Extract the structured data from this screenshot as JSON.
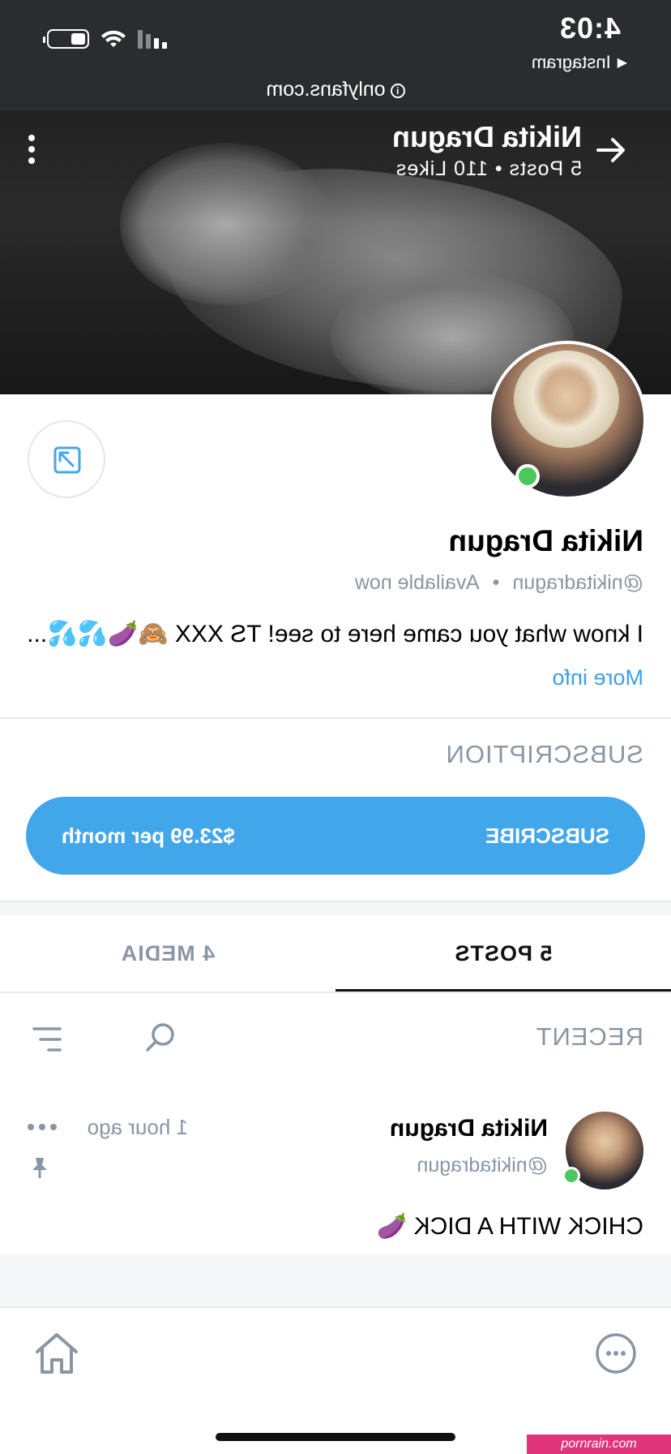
{
  "status_bar": {
    "time": "4:03",
    "back_app": "Instagram",
    "url": "onlyfans.com"
  },
  "cover": {
    "name": "Nikita Dragun",
    "stats": "5 Posts  •  110 Likes"
  },
  "profile": {
    "name": "Nikita Dragun",
    "handle": "@nikitadragun",
    "separator": "•",
    "availability": "Available now",
    "bio": "I know what you came here to see! TS XXX 🙈🍆💦💦...",
    "more_info": "More info"
  },
  "subscription": {
    "title": "SUBSCRIPTION",
    "button_label": "SUBSCRIBE",
    "price": "$23.99 per month"
  },
  "tabs": [
    {
      "label": "5 POSTS",
      "active": true
    },
    {
      "label": "4 MEDIA",
      "active": false
    }
  ],
  "feed": {
    "sort_label": "RECENT"
  },
  "post": {
    "author": "Nikita Dragun",
    "handle": "@nikitadragun",
    "time": "1 hour ago",
    "text": "CHICK WITH A DICK 🍆"
  },
  "watermark": "pornrain.com",
  "colors": {
    "accent": "#42a7ea",
    "online": "#4cc75e",
    "muted": "#8a96a3",
    "status_bar": "#2b2c30"
  },
  "icons": [
    "back-arrow-icon",
    "kebab-menu-icon",
    "share-icon",
    "search-icon",
    "filter-icon",
    "more-dots-icon",
    "pin-icon",
    "home-icon",
    "chat-icon"
  ]
}
